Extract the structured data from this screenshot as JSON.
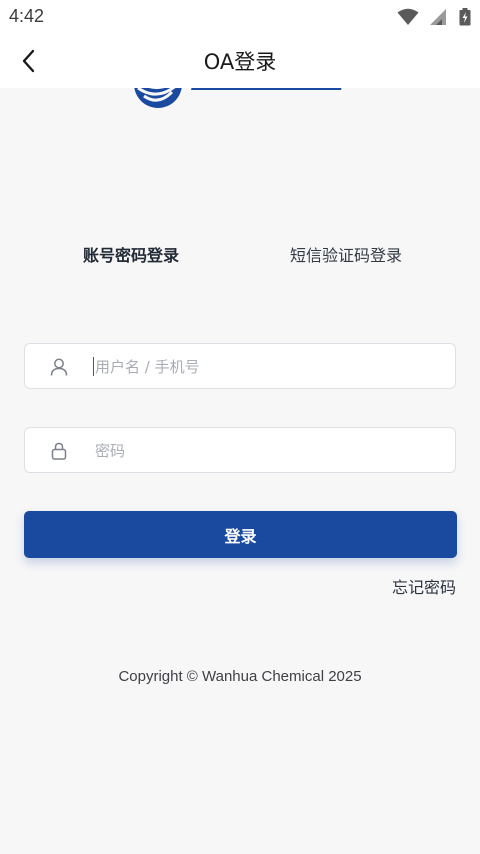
{
  "status_bar": {
    "time": "4:42",
    "icons": [
      "wifi-icon",
      "signal-icon",
      "battery-icon"
    ]
  },
  "header": {
    "title": "OA登录",
    "back_icon": "chevron-left-icon"
  },
  "logo": {
    "brand_color": "#1a49a0"
  },
  "tabs": [
    {
      "label": "账号密码登录",
      "active": true
    },
    {
      "label": "短信验证码登录",
      "active": false
    }
  ],
  "form": {
    "username": {
      "placeholder": "用户名 / 手机号",
      "value": "",
      "icon": "user-icon"
    },
    "password": {
      "placeholder": "密码",
      "value": "",
      "icon": "lock-icon"
    },
    "submit_label": "登录",
    "forgot_label": "忘记密码"
  },
  "footer": {
    "copyright": "Copyright © Wanhua Chemical  2025"
  },
  "colors": {
    "primary": "#1a49a0",
    "background": "#f7f7f8",
    "border": "#dcdfe4",
    "placeholder": "#a8acb3"
  }
}
